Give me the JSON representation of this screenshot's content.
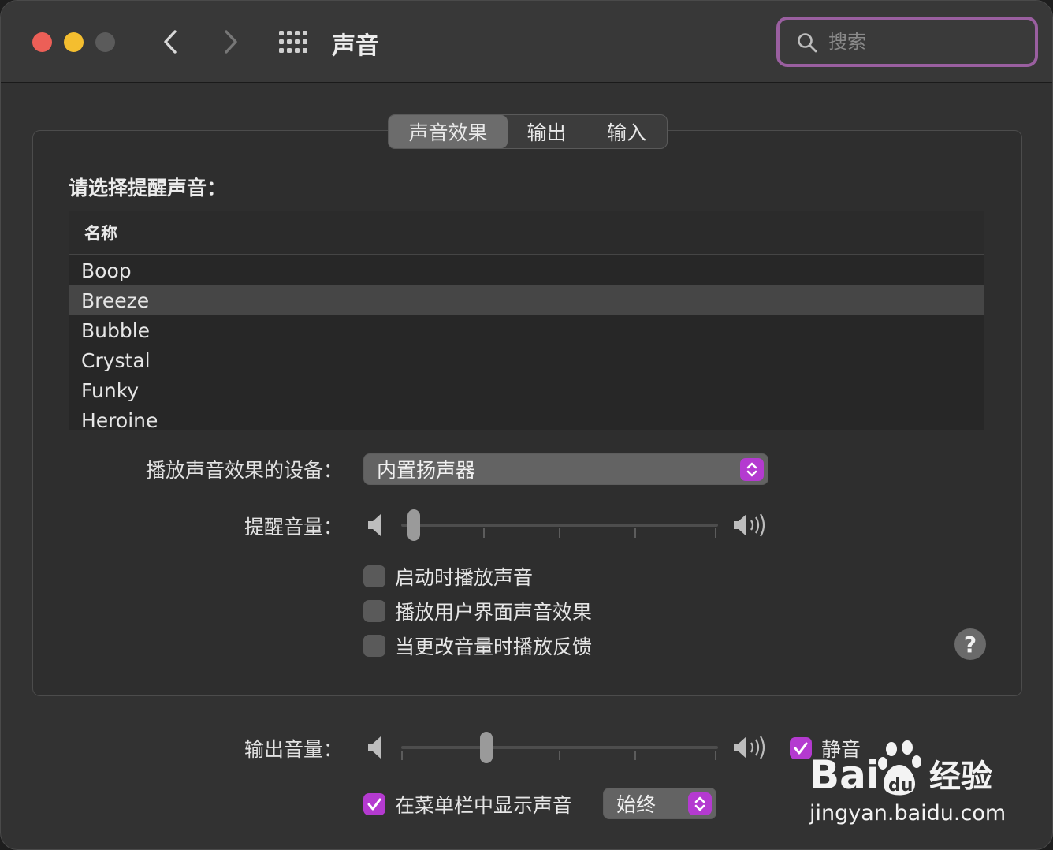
{
  "window": {
    "title": "声音",
    "search_placeholder": "搜索"
  },
  "icons": {
    "close": "close-icon",
    "minimize": "minimize-icon",
    "zoom": "zoom-icon",
    "back": "chevron-left-icon",
    "forward": "chevron-right-icon",
    "all_prefs": "grid-icon",
    "search": "search-icon",
    "volume_low": "speaker-low-icon",
    "volume_high": "speaker-high-icon",
    "popup": "chevron-updown-icon",
    "help": "help-icon"
  },
  "colors": {
    "accent": "#b43ad0",
    "search_focus": "#9a5fa0",
    "close": "#ec5f57",
    "minimize": "#f4be2f"
  },
  "tabs": [
    {
      "label": "声音效果",
      "active": true
    },
    {
      "label": "输出",
      "active": false
    },
    {
      "label": "输入",
      "active": false
    }
  ],
  "effects": {
    "section_label": "请选择提醒声音：",
    "list_header": "名称",
    "sounds": [
      "Boop",
      "Breeze",
      "Bubble",
      "Crystal",
      "Funky",
      "Heroine"
    ],
    "selected_sound": "Breeze",
    "device_label": "播放声音效果的设备：",
    "device_value": "内置扬声器",
    "alert_volume_label": "提醒音量：",
    "alert_volume_level": 0.02,
    "checkboxes": [
      {
        "label": "启动时播放声音",
        "checked": false
      },
      {
        "label": "播放用户界面声音效果",
        "checked": false
      },
      {
        "label": "当更改音量时播放反馈",
        "checked": false
      }
    ],
    "help_label": "?"
  },
  "output": {
    "volume_label": "输出音量：",
    "volume_level": 0.26,
    "mute_label": "静音",
    "mute_checked": true,
    "menubar_label": "在菜单栏中显示声音",
    "menubar_checked": true,
    "menubar_value": "始终"
  },
  "watermark": {
    "brand": "Bai du 经验",
    "url": "jingyan.baidu.com"
  }
}
